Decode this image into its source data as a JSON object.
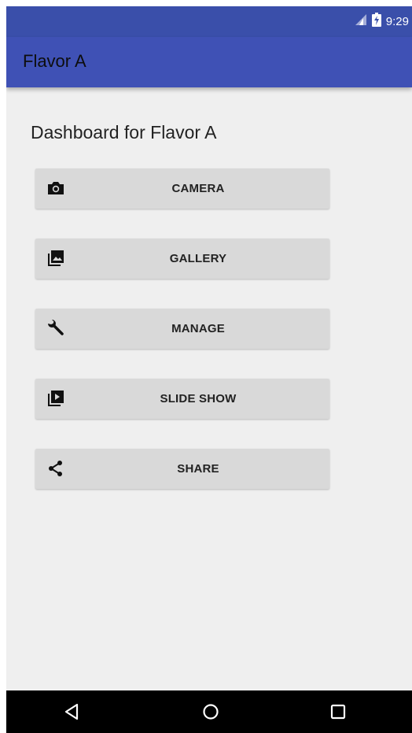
{
  "status_bar": {
    "time": "9:29",
    "background": "#3a4faa",
    "icons": [
      "signal-icon",
      "battery-icon"
    ]
  },
  "toolbar": {
    "title": "Flavor A",
    "background": "#3f51b5"
  },
  "dashboard": {
    "title": "Dashboard for Flavor A",
    "buttons": [
      {
        "label": "CAMERA",
        "icon": "camera-icon"
      },
      {
        "label": "GALLERY",
        "icon": "gallery-icon"
      },
      {
        "label": "MANAGE",
        "icon": "wrench-icon"
      },
      {
        "label": "SLIDE SHOW",
        "icon": "slideshow-icon"
      },
      {
        "label": "SHARE",
        "icon": "share-icon"
      }
    ]
  },
  "nav_bar": {
    "buttons": [
      "back-icon",
      "home-icon",
      "recents-icon"
    ],
    "background": "#000000"
  },
  "colors": {
    "content_background": "#efefef",
    "button_background": "#d9d9d9"
  }
}
